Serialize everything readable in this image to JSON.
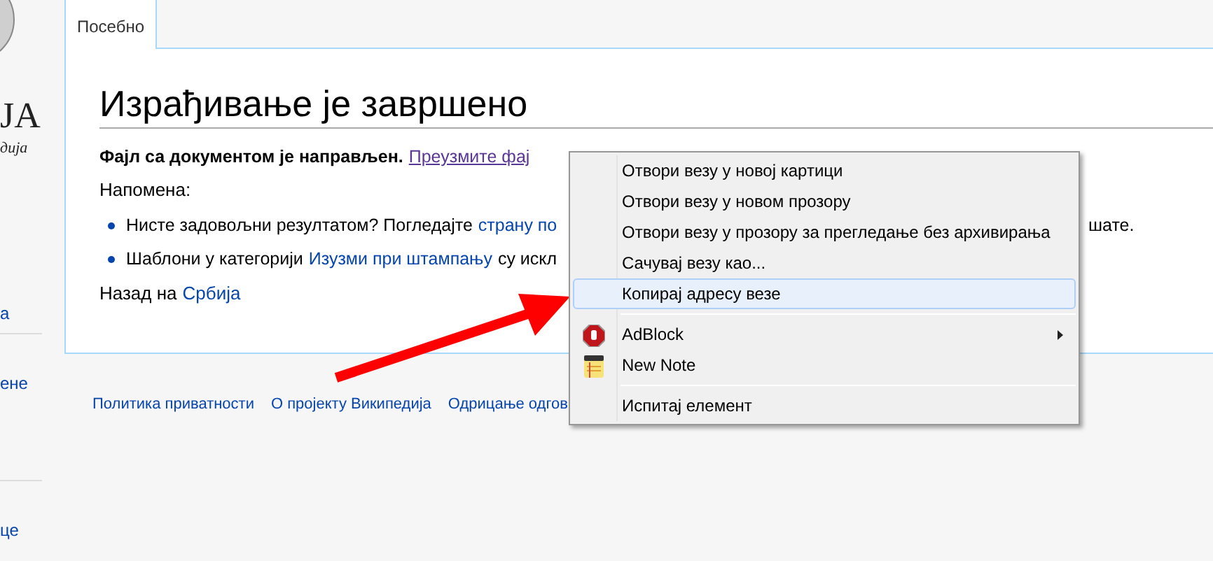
{
  "sidebar": {
    "logo_text": "ЈА",
    "logo_subtitle": "дија",
    "links": [
      "а",
      "ене",
      "це"
    ]
  },
  "tabs": [
    {
      "label": "Посебно",
      "selected": true
    }
  ],
  "content": {
    "title": "Израђивање је завршено",
    "lead": {
      "bold": "Фајл са документом је направљен.",
      "link": "Преузмите фај"
    },
    "note": "Напомена:",
    "bullets": [
      {
        "text": "Нисте задовољни резултатом? Погледајте",
        "link": "страну по",
        "overflow": "шате."
      },
      {
        "text": "Шаблони у категорији",
        "link": "Изузми при штампању",
        "text_after": "су искл"
      }
    ],
    "back": {
      "text": "Назад на",
      "link": "Србија"
    }
  },
  "footer": [
    "Политика приватности",
    "О пројекту Википедија",
    "Одрицање одгов"
  ],
  "context_menu": [
    {
      "kind": "item",
      "label": "Отвори везу у новој картици",
      "selected": false
    },
    {
      "kind": "item",
      "label": "Отвори везу у новом прозору",
      "selected": false
    },
    {
      "kind": "item",
      "label": "Отвори везу у прозору за прегледање без архивирања",
      "selected": false
    },
    {
      "kind": "item",
      "label": "Сачувај везу као...",
      "selected": false
    },
    {
      "kind": "item",
      "label": "Копирај адресу везе",
      "selected": true
    },
    {
      "kind": "separator"
    },
    {
      "kind": "extension",
      "label": "AdBlock",
      "submenu": true,
      "selected": false
    },
    {
      "kind": "extension",
      "label": "New Note",
      "selected": false
    },
    {
      "kind": "separator"
    },
    {
      "kind": "item",
      "label": "Испитај елемент",
      "selected": false
    }
  ]
}
